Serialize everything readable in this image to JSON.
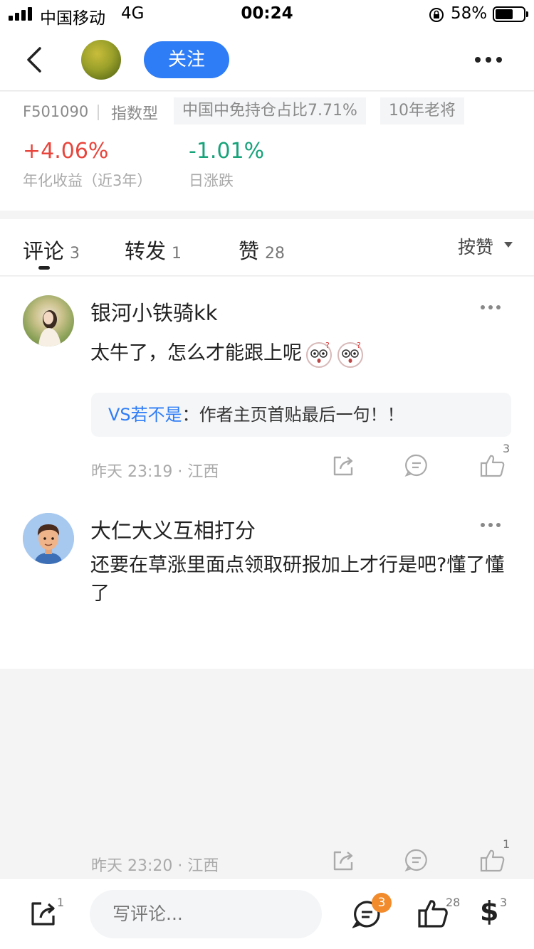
{
  "status_bar": {
    "carrier": "中国移动",
    "network": "4G",
    "time": "00:24",
    "battery": "58%",
    "battery_level": 0.58
  },
  "nav": {
    "back_icon": "chevron-left-icon",
    "follow_label": "关注",
    "more_icon": "more-horizontal-icon"
  },
  "fund": {
    "code": "F501090",
    "type": "指数型",
    "tags": [
      "中国中免持仓占比7.71%",
      "10年老将"
    ],
    "annual_return": "+4.06%",
    "annual_return_label": "年化收益（近3年）",
    "daily_change": "-1.01%",
    "daily_change_label": "日涨跌",
    "up_color": "#e8453c",
    "down_color": "#17a37a"
  },
  "tabs": [
    {
      "label": "评论",
      "count": "3"
    },
    {
      "label": "转发",
      "count": "1"
    },
    {
      "label": "赞",
      "count": "28"
    }
  ],
  "sort_label": "按赞",
  "comments": [
    {
      "user": "银河小铁骑kk",
      "text": "太牛了，怎么才能跟上呢",
      "emoji": "surprised-face-icon",
      "reply": {
        "name": "VS若不是",
        "sep": "：",
        "text": "作者主页首贴最后一句！！"
      },
      "meta": "昨天 23:19 · 江西",
      "likes": "3"
    },
    {
      "user": "大仁大义互相打分",
      "text": "还要在草涨里面点领取研报加上才行是吧?懂了懂了",
      "meta": "昨天 23:20 · 江西",
      "likes": "1"
    }
  ],
  "bottom_bar": {
    "share_count": "1",
    "input_placeholder": "写评论...",
    "comment_badge": "3",
    "like_count": "28",
    "reward_symbol": "$",
    "reward_count": "3",
    "accent_color": "#2f7df6",
    "badge_color": "#f28b2b"
  }
}
